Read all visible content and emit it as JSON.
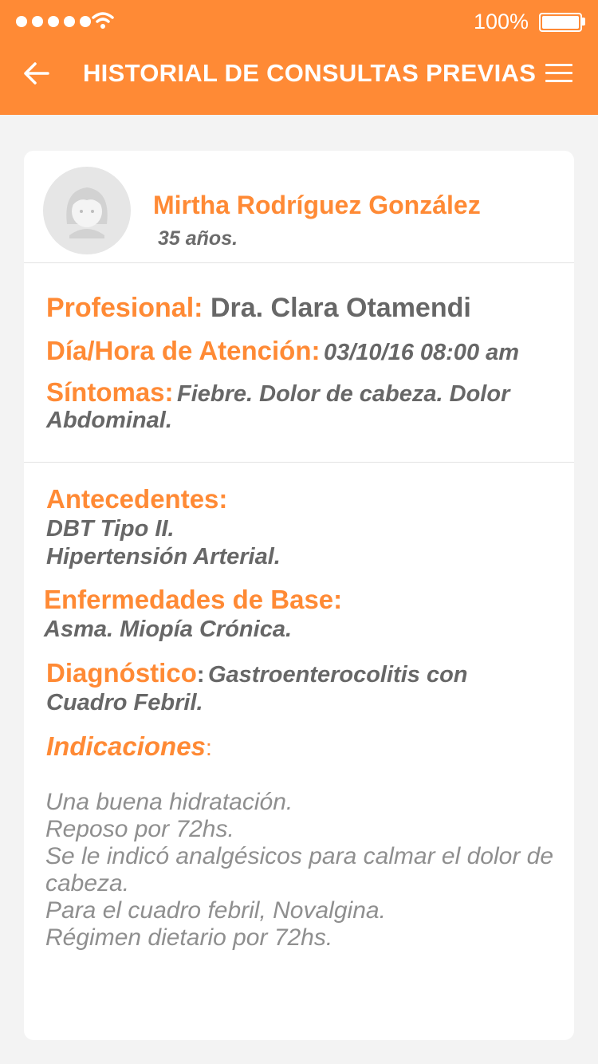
{
  "status_bar": {
    "signal_dots": 5,
    "battery_percent": "100%",
    "battery_level": 1.0
  },
  "header": {
    "title": "HISTORIAL DE CONSULTAS PREVIAS",
    "back_icon": "arrow-left-icon",
    "menu_icon": "hamburger-menu-icon"
  },
  "patient": {
    "name": "Mirtha Rodríguez González",
    "age": "35 años.",
    "avatar_icon": "female-avatar-icon"
  },
  "consultation": {
    "professional_label": "Profesional:",
    "professional_value": "Dra. Clara Otamendi",
    "datetime_label": "Día/Hora de Atención:",
    "datetime_value": "03/10/16 08:00 am",
    "symptoms_label": "Síntomas:",
    "symptoms_value_line1": "Fiebre. Dolor de cabeza. Dolor",
    "symptoms_value_line2": "Abdominal."
  },
  "history": {
    "antecedentes_label": "Antecedentes:",
    "antecedentes_lines": [
      "DBT Tipo II.",
      "Hipertensión Arterial."
    ],
    "enfermedades_label": "Enfermedades de Base:",
    "enfermedades_value": "Asma. Miopía Crónica.",
    "diagnostico_label": "Diagnóstico",
    "diagnostico_colon": ":",
    "diagnostico_value_line1": "Gastroenterocolitis  con",
    "diagnostico_value_line2": "Cuadro Febril.",
    "indicaciones_label": "Indicaciones",
    "indicaciones_colon": ":",
    "indicaciones_lines": [
      "Una buena hidratación.",
      "Reposo por 72hs.",
      "Se le indicó analgésicos para calmar el dolor de cabeza.",
      "Para el cuadro febril, Novalgina.",
      "Régimen dietario por 72hs."
    ]
  },
  "colors": {
    "accent": "#ff8a35",
    "text": "#676767",
    "muted": "#8f8f8f",
    "background": "#f3f3f3"
  }
}
